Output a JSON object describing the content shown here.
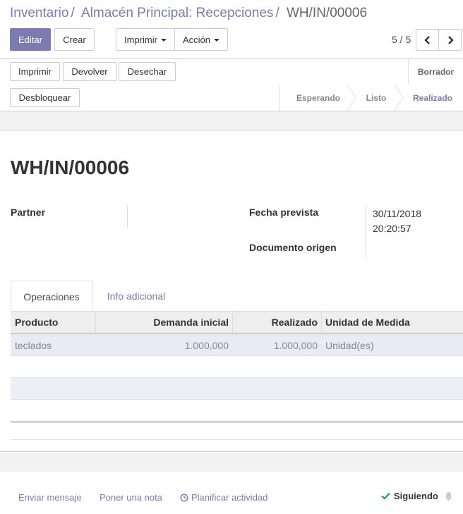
{
  "breadcrumb": {
    "items": [
      "Inventario",
      "Almacén Principal: Recepciones"
    ],
    "separator": "/",
    "current": "WH/IN/00006"
  },
  "toolbar": {
    "edit_label": "Editar",
    "create_label": "Crear",
    "print_label": "Imprimir",
    "action_label": "Acción"
  },
  "pager": {
    "value": "5 / 5"
  },
  "statusbar": {
    "buttons": [
      "Imprimir",
      "Devolver",
      "Desechar",
      "Desbloquear"
    ],
    "draft_label": "Borrador",
    "stages": [
      "Esperando",
      "Listo",
      "Realizado"
    ],
    "active_stage": "Realizado"
  },
  "form": {
    "title": "WH/IN/00006",
    "partner_label": "Partner",
    "scheduled_label": "Fecha prevista",
    "scheduled_date": "30/11/2018",
    "scheduled_time": "20:20:57",
    "origin_label": "Documento origen"
  },
  "tabs": [
    "Operaciones",
    "Info adicional"
  ],
  "table": {
    "columns": [
      "Producto",
      "Demanda inicial",
      "Realizado",
      "Unidad de Medida"
    ],
    "rows": [
      [
        "teclados",
        "1.000,000",
        "1.000,000",
        "Unidad(es)"
      ]
    ]
  },
  "chatter": {
    "send_message": "Enviar mensaje",
    "log_note": "Poner una nota",
    "schedule_activity": "Planificar actividad",
    "following": "Siguiendo"
  },
  "colors": {
    "accent": "#7c7bad",
    "check": "#28a745"
  },
  "icons": [
    "chevron-left-icon",
    "chevron-right-icon",
    "caret-down-icon",
    "clock-icon",
    "check-icon",
    "bell-icon"
  ]
}
